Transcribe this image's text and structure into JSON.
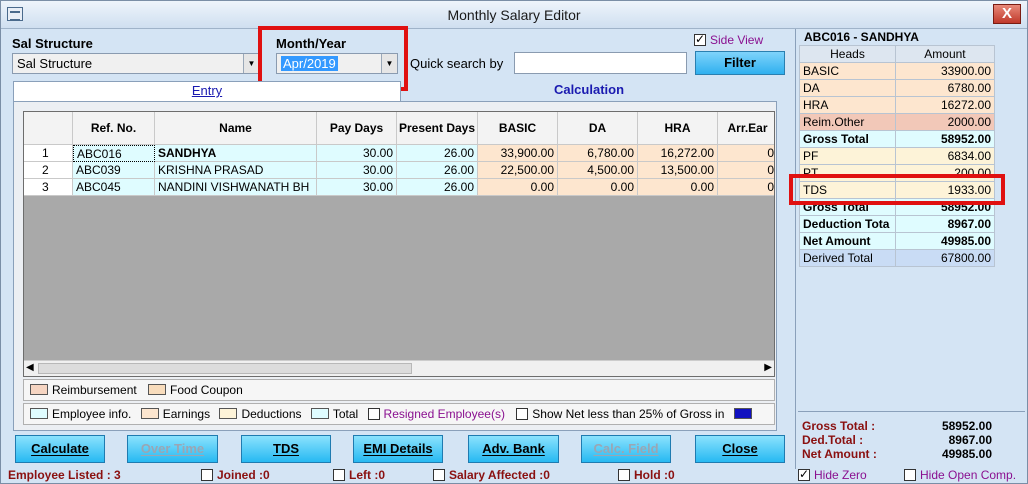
{
  "window": {
    "title": "Monthly Salary Editor",
    "close_label": "X"
  },
  "sal_structure": {
    "label": "Sal Structure",
    "value": "Sal Structure"
  },
  "month_year": {
    "label": "Month/Year",
    "value": "Apr/2019"
  },
  "quick_search": {
    "label": "Quick search by",
    "value": ""
  },
  "filter_label": "Filter",
  "side_view": {
    "label": "Side View",
    "checked": true
  },
  "tabs": {
    "entry": "Entry",
    "calculation": "Calculation"
  },
  "grid": {
    "headers": [
      "",
      "Ref. No.",
      "Name",
      "Pay Days",
      "Present Days",
      "BASIC",
      "DA",
      "HRA",
      "Arr.Ear"
    ],
    "rows": [
      {
        "idx": "1",
        "ref": "ABC016",
        "name": "SANDHYA",
        "pay_days": "30.00",
        "present_days": "26.00",
        "basic": "33,900.00",
        "da": "6,780.00",
        "hra": "16,272.00",
        "arr": "0"
      },
      {
        "idx": "2",
        "ref": "ABC039",
        "name": "KRISHNA PRASAD",
        "pay_days": "30.00",
        "present_days": "26.00",
        "basic": "22,500.00",
        "da": "4,500.00",
        "hra": "13,500.00",
        "arr": "0"
      },
      {
        "idx": "3",
        "ref": "ABC045",
        "name": "NANDINI VISHWANATH BH",
        "pay_days": "30.00",
        "present_days": "26.00",
        "basic": "0.00",
        "da": "0.00",
        "hra": "0.00",
        "arr": "0"
      }
    ]
  },
  "legend1": {
    "reimbursement": "Reimbursement",
    "food_coupon": "Food Coupon"
  },
  "legend2": {
    "employee_info": "Employee info.",
    "earnings": "Earnings",
    "deductions": "Deductions",
    "total": "Total",
    "resigned": "Resigned Employee(s)",
    "show_net": "Show Net less than 25% of Gross in"
  },
  "buttons": {
    "calculate": "Calculate",
    "over_time": "Over Time",
    "tds": "TDS",
    "emi_details": "EMI Details",
    "adv_bank": "Adv. Bank",
    "calc_field": "Calc. Field",
    "close": "Close"
  },
  "status": {
    "employee_listed": "Employee Listed : 3",
    "joined": "Joined :0",
    "left": "Left :0",
    "salary_affected": "Salary Affected :0",
    "hold": "Hold :0",
    "hide_zero": "Hide Zero",
    "hide_open_comp": "Hide Open Comp."
  },
  "side_panel": {
    "title": "ABC016 - SANDHYA",
    "head_col": "Heads",
    "amount_col": "Amount",
    "items": [
      {
        "head": "BASIC",
        "amount": "33900.00"
      },
      {
        "head": "DA",
        "amount": "6780.00"
      },
      {
        "head": "HRA",
        "amount": "16272.00"
      },
      {
        "head": "Reim.Other",
        "amount": "2000.00"
      },
      {
        "head": "Gross Total",
        "amount": "58952.00"
      },
      {
        "head": "PF",
        "amount": "6834.00"
      },
      {
        "head": "PT",
        "amount": "200.00"
      },
      {
        "head": "TDS",
        "amount": "1933.00"
      },
      {
        "head": "Gross Total",
        "amount": "58952.00"
      },
      {
        "head": "Deduction Tota",
        "amount": "8967.00"
      },
      {
        "head": "Net Amount",
        "amount": "49985.00"
      },
      {
        "head": "Derived Total",
        "amount": "67800.00"
      }
    ],
    "summary": {
      "gross_label": "Gross Total  :",
      "gross_value": "58952.00",
      "ded_label": "Ded.Total   :",
      "ded_value": "8967.00",
      "net_label": "Net Amount :",
      "net_value": "49985.00"
    }
  }
}
